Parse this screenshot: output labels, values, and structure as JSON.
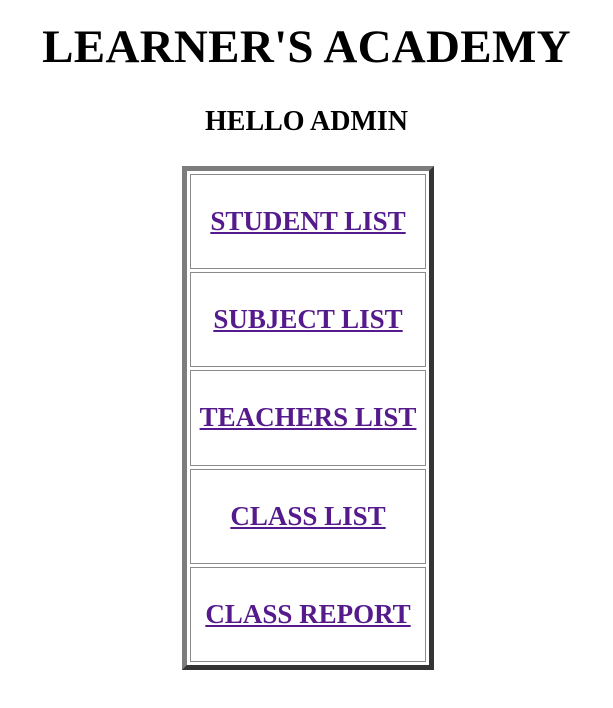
{
  "header": {
    "title": "LEARNER'S ACADEMY",
    "greeting": "HELLO ADMIN"
  },
  "colors": {
    "visited_link": "#551a8b",
    "background": "#ffffff"
  },
  "menu": {
    "items": [
      {
        "label": "STUDENT LIST"
      },
      {
        "label": "SUBJECT LIST"
      },
      {
        "label": "TEACHERS LIST"
      },
      {
        "label": "CLASS LIST"
      },
      {
        "label": "CLASS REPORT"
      }
    ]
  }
}
